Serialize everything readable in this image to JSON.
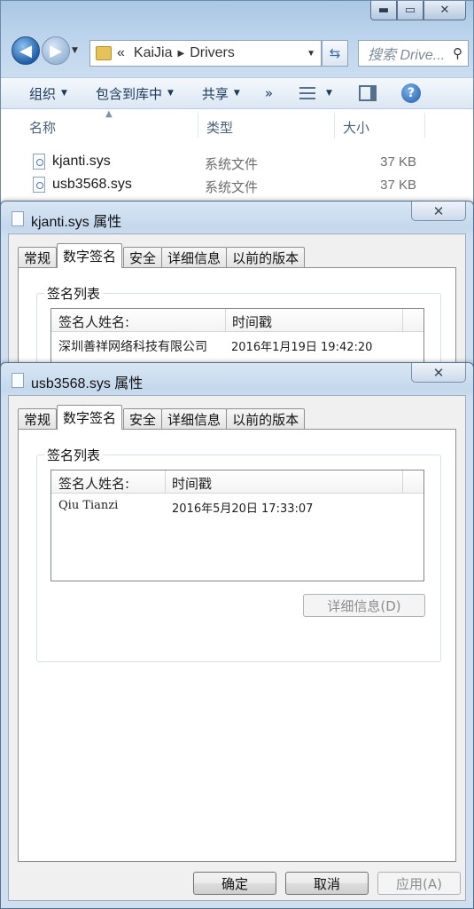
{
  "explorer": {
    "caption_buttons": {
      "minimize": "▬",
      "maximize": "▭",
      "close": "✕"
    },
    "address": {
      "overflow": "«",
      "crumbs": [
        "KaiJia",
        "Drivers"
      ]
    },
    "search": {
      "placeholder": "搜索 Drive..."
    },
    "toolbar": {
      "organize": "组织",
      "include_in_library": "包含到库中",
      "share": "共享",
      "more": "»"
    },
    "columns": {
      "name": "名称",
      "type": "类型",
      "size": "大小"
    },
    "files": [
      {
        "name": "kjanti.sys",
        "type": "系统文件",
        "size": "37 KB"
      },
      {
        "name": "usb3568.sys",
        "type": "系统文件",
        "size": "37 KB"
      }
    ]
  },
  "dialog1": {
    "title": "kjanti.sys 属性",
    "tabs": [
      "常规",
      "数字签名",
      "安全",
      "详细信息",
      "以前的版本"
    ],
    "active_tab": "数字签名",
    "group_label": "签名列表",
    "list_headers": {
      "signer": "签名人姓名:",
      "timestamp": "时间戳"
    },
    "rows": [
      {
        "signer": "深圳善祥网络科技有限公司",
        "timestamp": "2016年1月19日 19:42:20"
      }
    ]
  },
  "dialog2": {
    "title": "usb3568.sys 属性",
    "tabs": [
      "常规",
      "数字签名",
      "安全",
      "详细信息",
      "以前的版本"
    ],
    "active_tab": "数字签名",
    "group_label": "签名列表",
    "list_headers": {
      "signer": "签名人姓名:",
      "timestamp": "时间戳"
    },
    "rows": [
      {
        "signer": "Qiu Tianzi",
        "timestamp": "2016年5月20日 17:33:07"
      }
    ],
    "details_button": "详细信息(D)",
    "buttons": {
      "ok": "确定",
      "cancel": "取消",
      "apply": "应用(A)"
    }
  }
}
